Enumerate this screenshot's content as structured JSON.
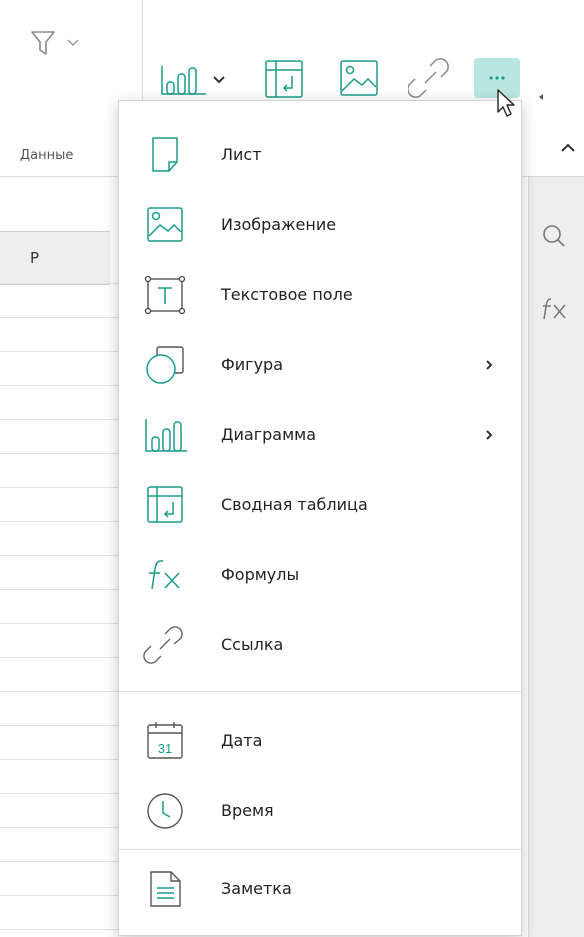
{
  "ribbon": {
    "group_label": "Данные"
  },
  "sheet": {
    "column_letter": "P"
  },
  "menu": {
    "items": [
      {
        "label": "Лист",
        "icon": "sheet-icon"
      },
      {
        "label": "Изображение",
        "icon": "image-icon"
      },
      {
        "label": "Текстовое поле",
        "icon": "text-box-icon"
      },
      {
        "label": "Фигура",
        "icon": "shape-icon",
        "submenu": true
      },
      {
        "label": "Диаграмма",
        "icon": "chart-icon",
        "submenu": true
      },
      {
        "label": "Сводная таблица",
        "icon": "pivot-table-icon"
      },
      {
        "label": "Формулы",
        "icon": "formula-icon"
      },
      {
        "label": "Ссылка",
        "icon": "link-icon"
      },
      {
        "label": "Дата",
        "icon": "calendar-icon",
        "date_number": "31"
      },
      {
        "label": "Время",
        "icon": "clock-icon"
      },
      {
        "label": "Заметка",
        "icon": "note-icon"
      }
    ]
  },
  "colors": {
    "accent": "#1a9c8c",
    "more_button_bg": "#b9e6e0",
    "icon_gray": "#7a7a7a"
  }
}
